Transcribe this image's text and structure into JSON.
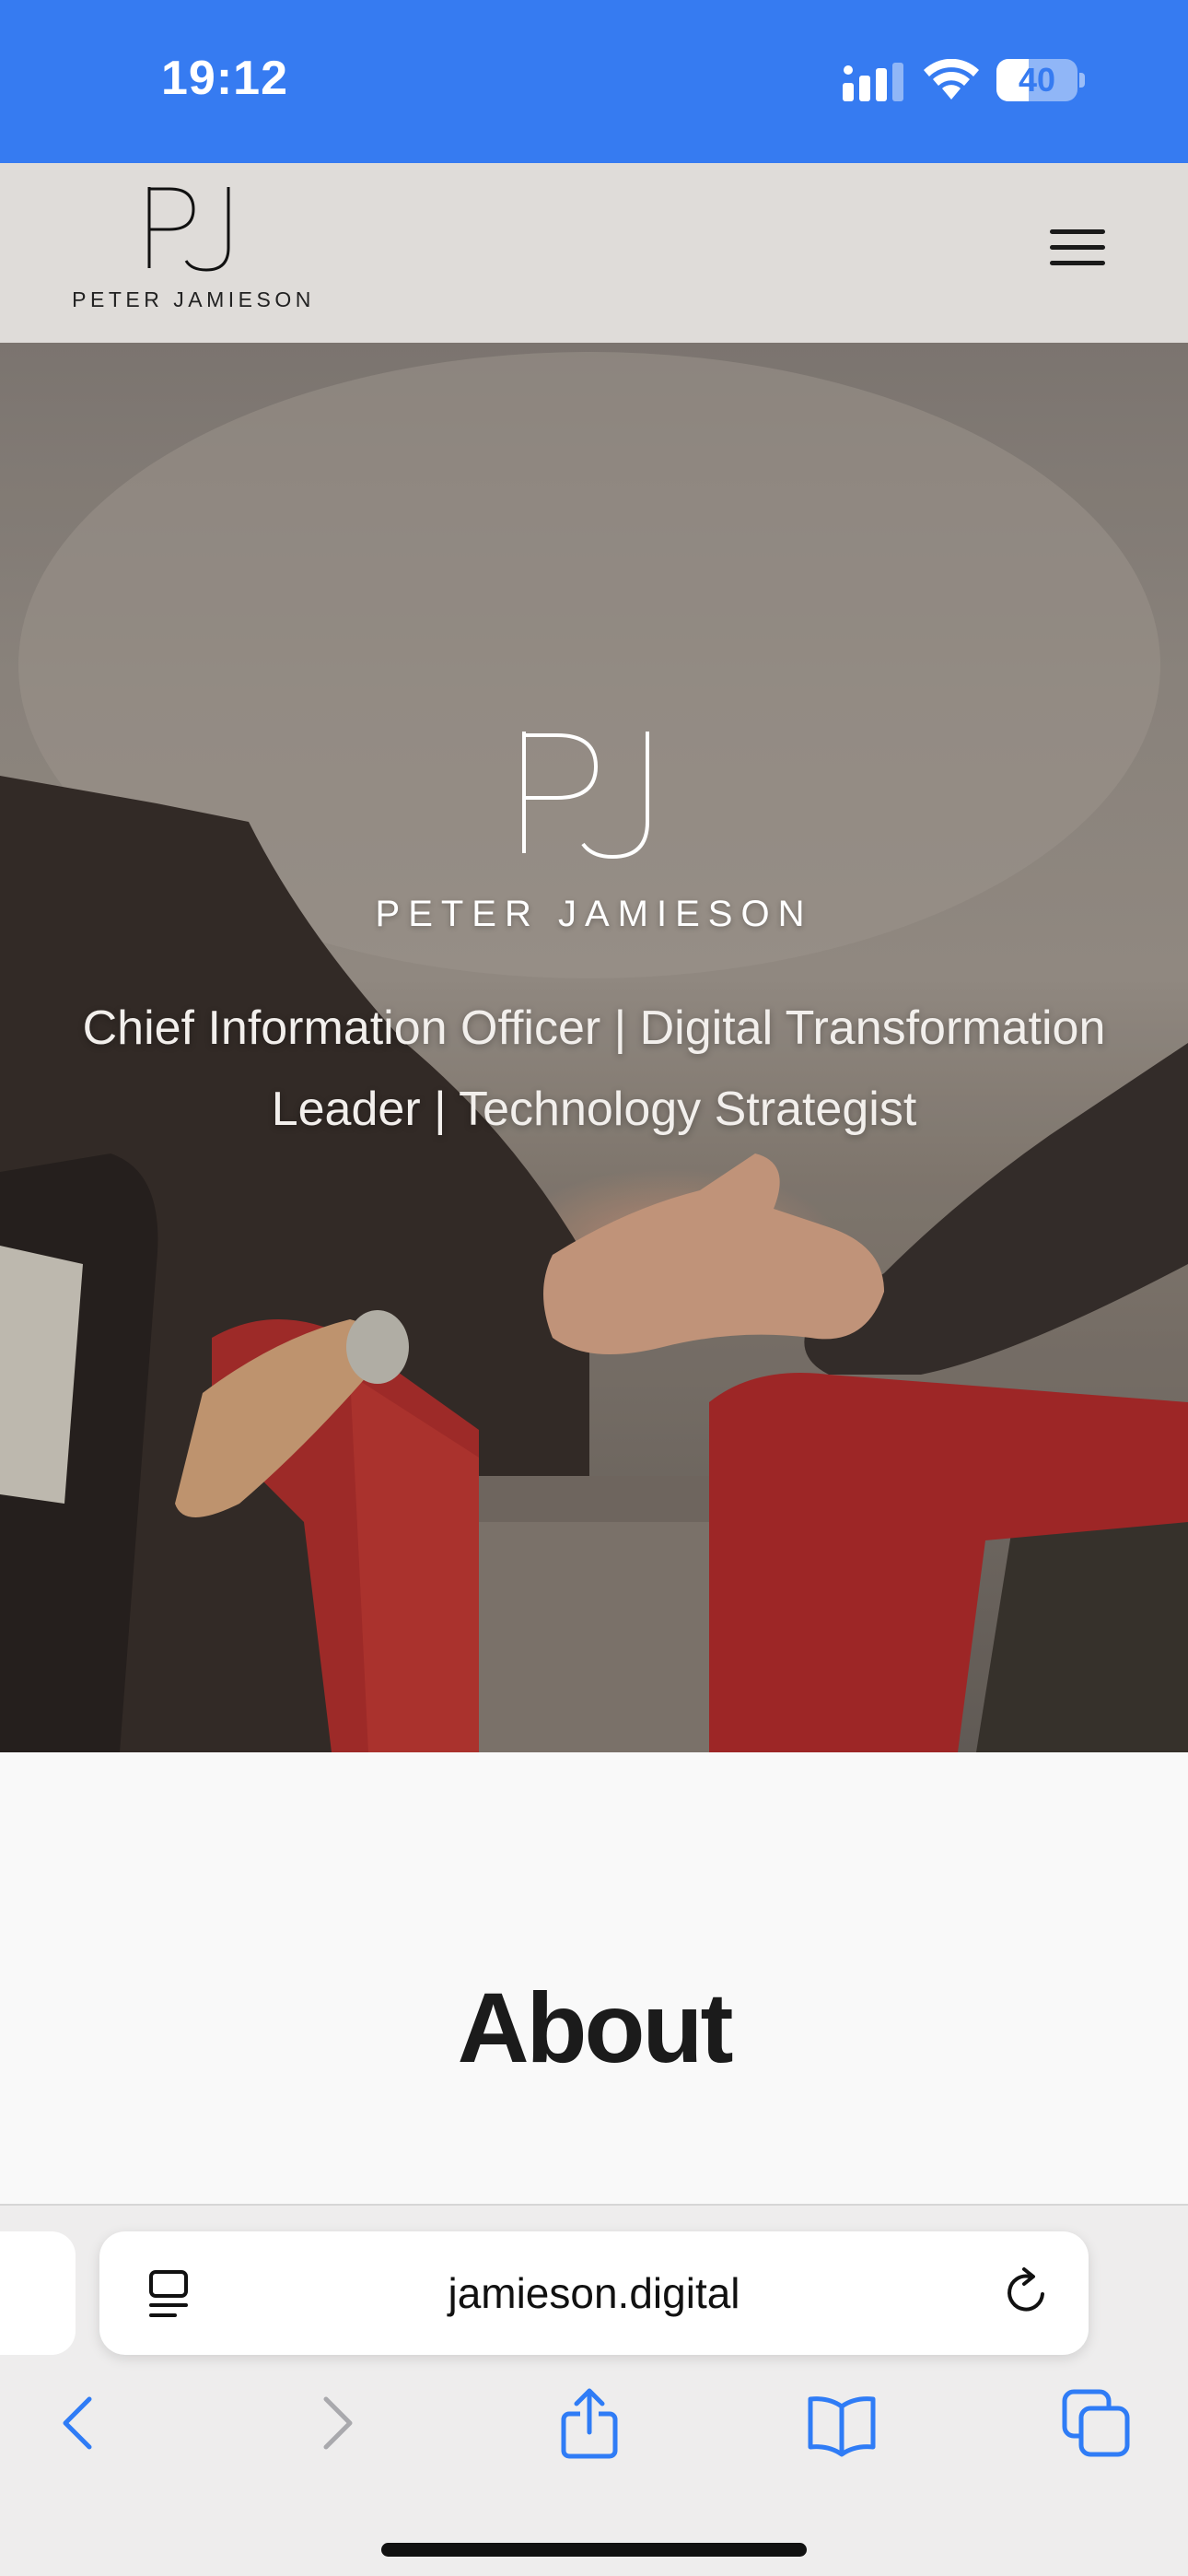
{
  "status_bar": {
    "time": "19:12",
    "battery_level": "40",
    "battery_fraction": 0.4,
    "background_color": "#367bf1",
    "icons": [
      "signal-icon",
      "wifi-icon",
      "battery-icon"
    ]
  },
  "header": {
    "logo_monogram": "PJ",
    "logo_name": "PETER JAMIESON",
    "menu_icon": "hamburger-menu-icon",
    "background_color": "#dfdcd9"
  },
  "hero": {
    "monogram": "PJ",
    "name": "PETER JAMIESON",
    "tagline": "Chief Information Officer | Digital Transformation Leader | Technology Strategist"
  },
  "about": {
    "title": "About"
  },
  "browser": {
    "url": "jamieson.digital",
    "icons": [
      "reader-view-icon",
      "reload-icon",
      "back-icon",
      "forward-icon",
      "share-icon",
      "bookmarks-icon",
      "tabs-icon"
    ],
    "accent_color": "#2f7cf6"
  }
}
